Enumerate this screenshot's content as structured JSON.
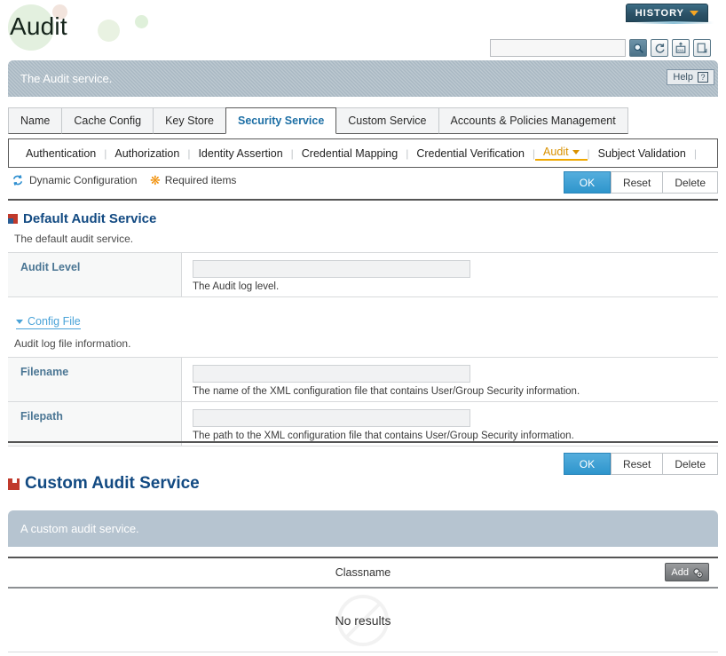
{
  "header": {
    "app_title": "Audit",
    "history_button": "HISTORY",
    "search_value": "",
    "search_placeholder": "",
    "toolbar_icons": [
      "search-icon",
      "refresh-icon",
      "export-xml-icon",
      "export-doc-icon"
    ]
  },
  "banner": {
    "text": "The Audit service.",
    "help_label": "Help"
  },
  "tabs": [
    {
      "label": "Name",
      "active": false
    },
    {
      "label": "Cache Config",
      "active": false
    },
    {
      "label": "Key Store",
      "active": false
    },
    {
      "label": "Security Service",
      "active": true
    },
    {
      "label": "Custom Service",
      "active": false
    },
    {
      "label": "Accounts & Policies Management",
      "active": false
    }
  ],
  "subnav": [
    {
      "label": "Authentication",
      "active": false
    },
    {
      "label": "Authorization",
      "active": false
    },
    {
      "label": "Identity Assertion",
      "active": false
    },
    {
      "label": "Credential Mapping",
      "active": false
    },
    {
      "label": "Credential Verification",
      "active": false
    },
    {
      "label": "Audit",
      "active": true
    },
    {
      "label": "Subject Validation",
      "active": false
    }
  ],
  "actions": {
    "dynamic_configuration": "Dynamic Configuration",
    "required_items": "Required items",
    "ok_label": "OK",
    "reset_label": "Reset",
    "delete_label": "Delete"
  },
  "default_service": {
    "title": "Default Audit Service",
    "description": "The default audit service.",
    "fields": [
      {
        "label": "Audit Level",
        "value": "",
        "hint": "The Audit log level."
      }
    ],
    "config_file": {
      "link_label": "Config File",
      "description": "Audit log file information.",
      "fields": [
        {
          "label": "Filename",
          "value": "",
          "hint": "The name of the XML configuration file that contains User/Group Security information."
        },
        {
          "label": "Filepath",
          "value": "",
          "hint": "The path to the XML configuration file that contains User/Group Security information."
        }
      ]
    }
  },
  "custom_service": {
    "title": "Custom Audit Service",
    "banner_text": "A custom audit service.",
    "table": {
      "column_header": "Classname",
      "add_label": "Add",
      "empty_message": "No results"
    }
  },
  "colors": {
    "accent_blue": "#2e95cc",
    "title_blue": "#124a82",
    "active_tab_blue": "#1d6fa5",
    "audit_orange": "#d99100",
    "banner_gray": "#a9b8c3",
    "history_teal": "#2c5267"
  }
}
